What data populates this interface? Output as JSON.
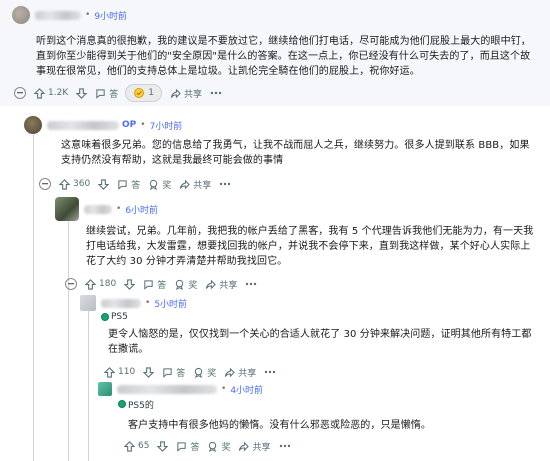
{
  "comments": [
    {
      "id": "c1",
      "time": "9小时前",
      "body": "听到这个消息真的很抱歉，我的建议是不要放过它，继续给他们打电话，尽可能成为他们屁股上最大的眼中钉，直到你至少能得到关于他们的\"安全原因\"是什么的答案。在这一点上，你已经没有什么可失去的了，而且这个故事现在很常见，他们的支持总体上是垃圾。让凯伦完全騎在他们的屁股上，祝你好运。",
      "votes": "1.2K",
      "reply_label": "答",
      "award_count": "1",
      "share_label": "共享"
    },
    {
      "id": "c2",
      "op_badge": "OP",
      "time": "7小时前",
      "body": "这意味着很多兄弟。您的信息给了我勇气，让我不战而屈人之兵，继续努力。很多人提到联系 BBB，如果支持仍然没有帮助，这就是我最终可能会做的事情",
      "votes": "360",
      "reply_label": "答",
      "award_label": "奖",
      "share_label": "共享"
    },
    {
      "id": "c3",
      "time": "6小时前",
      "body": "继续尝试，兄弟。几年前，我把我的帐户丢给了黑客，我有 5 个代理告诉我他们无能为力，有一天我打电话给我，大发雷霆，想要找回我的帐户，并说我不会停下来，直到我这样做，某个好心人实际上花了大约 30 分钟才弄清楚并帮助我找回它。",
      "votes": "180",
      "reply_label": "答",
      "award_label": "奖",
      "share_label": "共享"
    },
    {
      "id": "c4",
      "flair": "PS5",
      "time": "5小时前",
      "body": "更令人恼怒的是，仅仅找到一个关心的合适人就花了 30 分钟来解决问题，证明其他所有特工都在撒谎。",
      "votes": "110",
      "reply_label": "答",
      "award_label": "奖",
      "share_label": "共享"
    },
    {
      "id": "c5",
      "flair": "PS5的",
      "time": "4小时前",
      "body": "客户支持中有很多他妈的懒惰。没有什么邪恶或险恶的，只是懒惰。",
      "votes": "65",
      "reply_label": "答",
      "award_label": "奖",
      "share_label": "共享"
    }
  ],
  "colors": {
    "accent": "#4a6cf7",
    "flair_green": "#1aa36f",
    "text": "#1a1a1b",
    "muted": "#576f76"
  },
  "icons": [
    "avatar",
    "upvote-icon",
    "downvote-icon",
    "reply-icon",
    "award-icon",
    "share-icon",
    "more-icon",
    "collapse-icon"
  ]
}
